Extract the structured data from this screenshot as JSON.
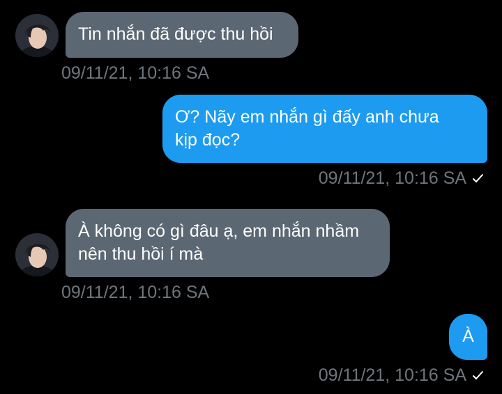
{
  "messages": [
    {
      "direction": "incoming",
      "lines": [
        "Tin nhắn đã được thu hồi"
      ],
      "timestamp": "09/11/21, 10:16 SA"
    },
    {
      "direction": "outgoing",
      "lines": [
        "Ơ? Nãy em nhắn gì đấy anh chưa",
        "kịp đọc?"
      ],
      "timestamp": "09/11/21, 10:16 SA",
      "status_icon": "check-icon"
    },
    {
      "direction": "incoming",
      "lines": [
        "À không có gì đâu ạ, em nhắn nhầm",
        "nên thu hồi í mà"
      ],
      "timestamp": "09/11/21, 10:16 SA"
    },
    {
      "direction": "outgoing",
      "lines": [
        "À"
      ],
      "timestamp": "09/11/21, 10:16 SA",
      "status_icon": "check-icon"
    }
  ],
  "colors": {
    "background": "#000000",
    "incoming_bubble": "#5b6773",
    "outgoing_bubble": "#1d9bf0",
    "timestamp_text": "#6e767d",
    "message_text": "#ffffff"
  }
}
